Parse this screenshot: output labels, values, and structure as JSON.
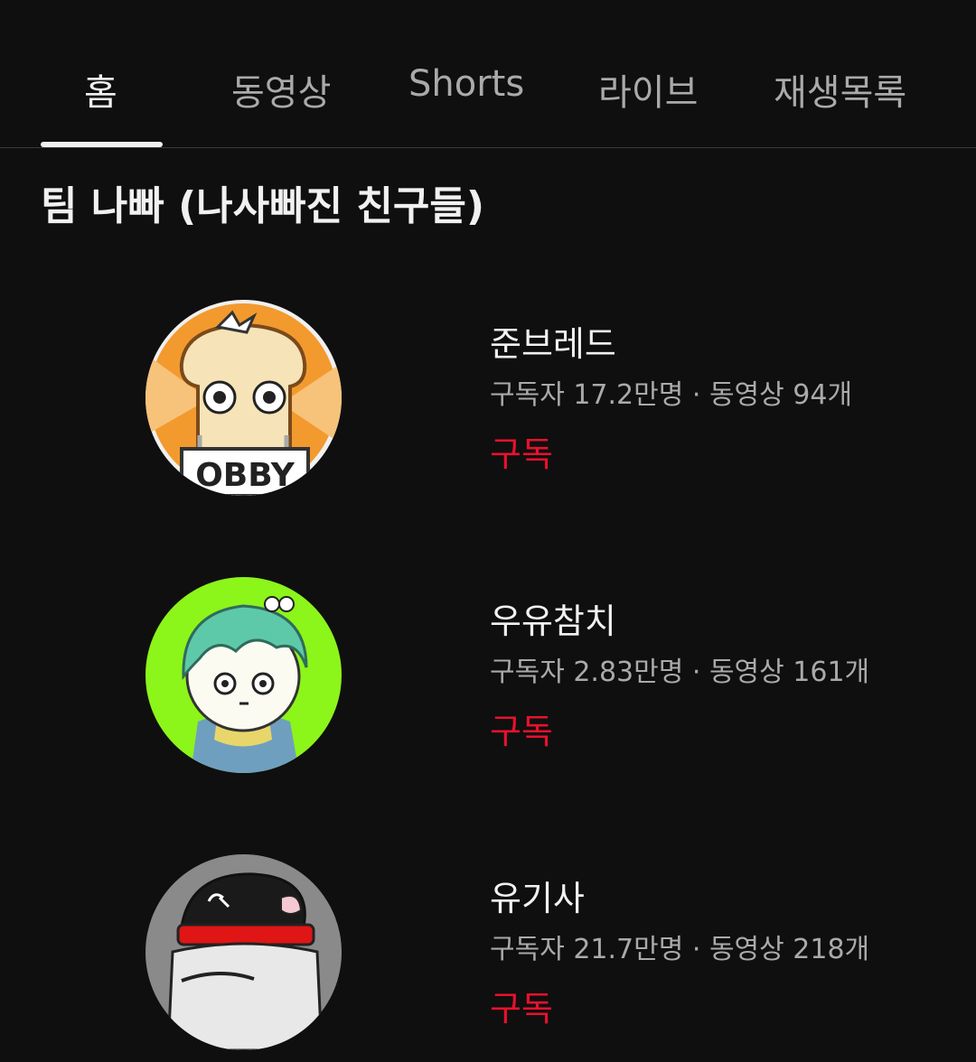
{
  "tabs": [
    {
      "label": "홈",
      "active": true
    },
    {
      "label": "동영상",
      "active": false
    },
    {
      "label": "Shorts",
      "active": false
    },
    {
      "label": "라이브",
      "active": false
    },
    {
      "label": "재생목록",
      "active": false
    }
  ],
  "section": {
    "title": "팀 나빠 (나사빠진 친구들)"
  },
  "channels": [
    {
      "name": "준브레드",
      "meta": "구독자 17.2만명 · 동영상 94개",
      "subscribe_label": "구독",
      "avatar_text": "OBBY"
    },
    {
      "name": "우유참치",
      "meta": "구독자 2.83만명 · 동영상 161개",
      "subscribe_label": "구독"
    },
    {
      "name": "유기사",
      "meta": "구독자 21.7만명 · 동영상 218개",
      "subscribe_label": "구독"
    }
  ],
  "colors": {
    "background": "#0f0f0f",
    "subscribe": "#e8112d",
    "secondary_text": "#aaaaaa"
  }
}
